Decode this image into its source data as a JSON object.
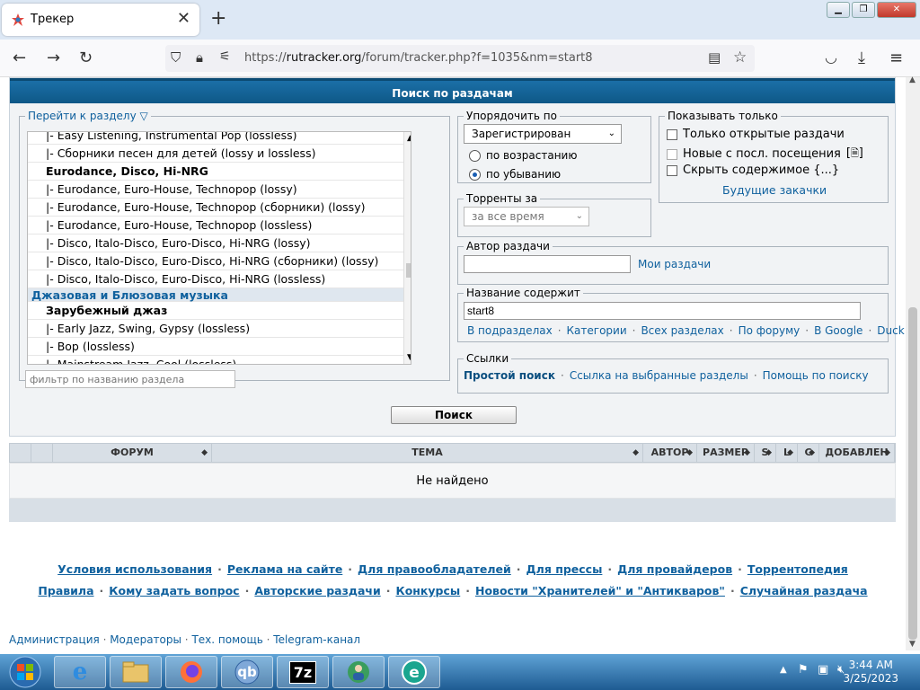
{
  "browser": {
    "tab_title": "Трекер",
    "tab_close": "✕",
    "new_tab": "+",
    "url_prefix": "https://",
    "url_host": "rutracker.org",
    "url_path": "/forum/tracker.php?f=1035&nm=start8"
  },
  "search": {
    "header": "Поиск по раздачам",
    "forums_legend": "Перейти к разделу",
    "forums": [
      {
        "label": "|- Easy Listening, Instrumental Pop (lossless)",
        "kind": "item"
      },
      {
        "label": "|- Сборники песен для детей (lossy и lossless)",
        "kind": "item"
      },
      {
        "label": "Eurodance, Disco, Hi-NRG",
        "kind": "cat"
      },
      {
        "label": "|- Eurodance, Euro-House, Technopop (lossy)",
        "kind": "item"
      },
      {
        "label": "|- Eurodance, Euro-House, Technopop (сборники) (lossy)",
        "kind": "item"
      },
      {
        "label": "|- Eurodance, Euro-House, Technopop (lossless)",
        "kind": "item"
      },
      {
        "label": "|- Disco, Italo-Disco, Euro-Disco, Hi-NRG (lossy)",
        "kind": "item"
      },
      {
        "label": "|- Disco, Italo-Disco, Euro-Disco, Hi-NRG (сборники) (lossy)",
        "kind": "item"
      },
      {
        "label": "|- Disco, Italo-Disco, Euro-Disco, Hi-NRG (lossless)",
        "kind": "item"
      },
      {
        "label": "Джазовая и Блюзовая музыка",
        "kind": "group"
      },
      {
        "label": "Зарубежный джаз",
        "kind": "cat"
      },
      {
        "label": "|- Early Jazz, Swing, Gypsy (lossless)",
        "kind": "item"
      },
      {
        "label": "|- Bop (lossless)",
        "kind": "item"
      },
      {
        "label": "|- Mainstream Jazz, Cool (lossless)",
        "kind": "item"
      }
    ],
    "filter_placeholder": "фильтр по названию раздела",
    "order_legend": "Упорядочить по",
    "order_value": "Зарегистрирован",
    "order_asc": "по возрастанию",
    "order_desc": "по убыванию",
    "show_legend": "Показывать только",
    "show_open": "Только открытые раздачи",
    "show_new": "Новые с посл. посещения",
    "show_new_suffix": "[",
    "show_new_end": "]",
    "show_hide": "Скрыть содержимое {...}",
    "future": "Будущие закачки",
    "torrents_legend": "Торренты за",
    "torrents_value": "за все время",
    "author_legend": "Автор раздачи",
    "my_torrents": "Мои раздачи",
    "name_legend": "Название содержит",
    "name_value": "start8",
    "name_links": [
      "В подразделах",
      "Категории",
      "Всех разделах",
      "По форуму",
      "В Google",
      "Duck"
    ],
    "links_legend": "Ссылки",
    "simple_search": "Простой поиск",
    "link_selected": "Ссылка на выбранные разделы",
    "help": "Помощь по поиску",
    "button": "Поиск"
  },
  "results": {
    "columns": [
      "ФОРУМ",
      "ТЕМА",
      "АВТОР",
      "РАЗМЕР",
      "S",
      "L",
      "C",
      "ДОБАВЛЕН"
    ],
    "empty": "Не найдено"
  },
  "footer": {
    "line1": [
      "Условия использования",
      "Реклама на сайте",
      "Для правообладателей",
      "Для прессы",
      "Для провайдеров",
      "Торрентопедия"
    ],
    "line2": [
      "Правила",
      "Кому задать вопрос",
      "Авторские раздачи",
      "Конкурсы",
      "Новости \"Хранителей\" и \"Антикваров\"",
      "Случайная раздача"
    ],
    "admin": [
      "Администрация",
      "Модераторы",
      "Тех. помощь",
      "Telegram-канал"
    ]
  },
  "taskbar": {
    "time": "3:44 AM",
    "date": "3/25/2023",
    "apps": [
      "ie-icon",
      "explorer-icon",
      "firefox-icon",
      "qbittorrent-icon",
      "7zip-icon",
      "user-app-icon",
      "edge-icon"
    ],
    "qb_label": "qb",
    "zip_label": "7z"
  }
}
